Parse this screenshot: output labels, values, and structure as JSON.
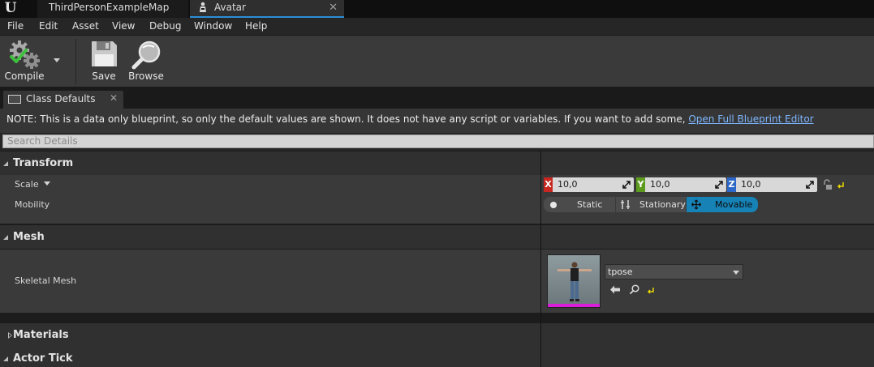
{
  "tabs": [
    {
      "label": "ThirdPersonExampleMap",
      "active": false
    },
    {
      "label": "Avatar",
      "active": true
    }
  ],
  "menu": [
    "File",
    "Edit",
    "Asset",
    "View",
    "Debug",
    "Window",
    "Help"
  ],
  "toolbar": {
    "compile_label": "Compile",
    "save_label": "Save",
    "browse_label": "Browse"
  },
  "details_tab": {
    "label": "Class Defaults"
  },
  "note": {
    "text": "NOTE: This is a data only blueprint, so only the default values are shown.  It does not have any script or variables.  If you want to add some, ",
    "link": "Open Full Blueprint Editor"
  },
  "search": {
    "placeholder": "Search Details"
  },
  "categories": {
    "transform": "Transform",
    "mesh": "Mesh",
    "materials": "Materials",
    "actor_tick": "Actor Tick"
  },
  "transform": {
    "scale_label": "Scale",
    "scale": {
      "x_axis": "X",
      "x": "10,0",
      "y_axis": "Y",
      "y": "10,0",
      "z_axis": "Z",
      "z": "10,0"
    },
    "mobility_label": "Mobility",
    "mobility_options": [
      "Static",
      "Stationary",
      "Movable"
    ],
    "mobility_selected": "Movable"
  },
  "mesh": {
    "skeletal_mesh_label": "Skeletal Mesh",
    "skeletal_mesh_value": "tpose"
  },
  "colors": {
    "accent": "#2c8fd6",
    "selected": "#1782b5",
    "x_axis": "#c8261f",
    "y_axis": "#5d9b1e",
    "z_axis": "#2c67c9",
    "link": "#7fb7ff"
  }
}
